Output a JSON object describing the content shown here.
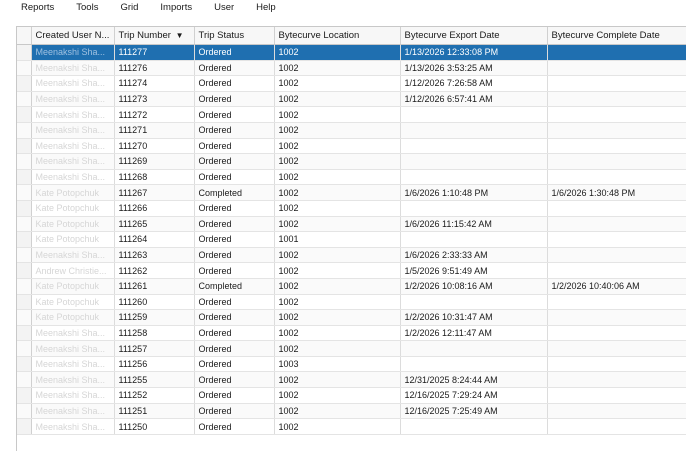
{
  "menu": [
    "Reports",
    "Tools",
    "Grid",
    "Imports",
    "User",
    "Help"
  ],
  "columns": {
    "created_user": "Created User N...",
    "trip_number": "Trip Number",
    "sort_indicator": "▼",
    "trip_status": "Trip Status",
    "bytecurve_location": "Bytecurve Location",
    "bytecurve_export_date": "Bytecurve Export Date",
    "bytecurve_complete_date": "Bytecurve Complete Date"
  },
  "rows": [
    {
      "user": "Meenakshi Sha...",
      "trip": "111277",
      "status": "Ordered",
      "location": "1002",
      "export": "1/13/2026 12:33:08 PM",
      "complete": "",
      "selected": true
    },
    {
      "user": "Meenakshi Sha...",
      "trip": "111276",
      "status": "Ordered",
      "location": "1002",
      "export": "1/13/2026 3:53:25 AM",
      "complete": ""
    },
    {
      "user": "Meenakshi Sha...",
      "trip": "111274",
      "status": "Ordered",
      "location": "1002",
      "export": "1/12/2026 7:26:58 AM",
      "complete": ""
    },
    {
      "user": "Meenakshi Sha...",
      "trip": "111273",
      "status": "Ordered",
      "location": "1002",
      "export": "1/12/2026 6:57:41 AM",
      "complete": ""
    },
    {
      "user": "Meenakshi Sha...",
      "trip": "111272",
      "status": "Ordered",
      "location": "1002",
      "export": "",
      "complete": ""
    },
    {
      "user": "Meenakshi Sha...",
      "trip": "111271",
      "status": "Ordered",
      "location": "1002",
      "export": "",
      "complete": ""
    },
    {
      "user": "Meenakshi Sha...",
      "trip": "111270",
      "status": "Ordered",
      "location": "1002",
      "export": "",
      "complete": ""
    },
    {
      "user": "Meenakshi Sha...",
      "trip": "111269",
      "status": "Ordered",
      "location": "1002",
      "export": "",
      "complete": ""
    },
    {
      "user": "Meenakshi Sha...",
      "trip": "111268",
      "status": "Ordered",
      "location": "1002",
      "export": "",
      "complete": ""
    },
    {
      "user": "Kate Potopchuk",
      "trip": "111267",
      "status": "Completed",
      "location": "1002",
      "export": "1/6/2026 1:10:48 PM",
      "complete": "1/6/2026 1:30:48 PM"
    },
    {
      "user": "Kate Potopchuk",
      "trip": "111266",
      "status": "Ordered",
      "location": "1002",
      "export": "",
      "complete": ""
    },
    {
      "user": "Kate Potopchuk",
      "trip": "111265",
      "status": "Ordered",
      "location": "1002",
      "export": "1/6/2026 11:15:42 AM",
      "complete": ""
    },
    {
      "user": "Kate Potopchuk",
      "trip": "111264",
      "status": "Ordered",
      "location": "1001",
      "export": "",
      "complete": ""
    },
    {
      "user": "Meenakshi Sha...",
      "trip": "111263",
      "status": "Ordered",
      "location": "1002",
      "export": "1/6/2026 2:33:33 AM",
      "complete": ""
    },
    {
      "user": "Andrew Christie...",
      "trip": "111262",
      "status": "Ordered",
      "location": "1002",
      "export": "1/5/2026 9:51:49 AM",
      "complete": ""
    },
    {
      "user": "Kate Potopchuk",
      "trip": "111261",
      "status": "Completed",
      "location": "1002",
      "export": "1/2/2026 10:08:16 AM",
      "complete": "1/2/2026 10:40:06 AM"
    },
    {
      "user": "Kate Potopchuk",
      "trip": "111260",
      "status": "Ordered",
      "location": "1002",
      "export": "",
      "complete": ""
    },
    {
      "user": "Kate Potopchuk",
      "trip": "111259",
      "status": "Ordered",
      "location": "1002",
      "export": "1/2/2026 10:31:47 AM",
      "complete": ""
    },
    {
      "user": "Meenakshi Sha...",
      "trip": "111258",
      "status": "Ordered",
      "location": "1002",
      "export": "1/2/2026 12:11:47 AM",
      "complete": ""
    },
    {
      "user": "Meenakshi Sha...",
      "trip": "111257",
      "status": "Ordered",
      "location": "1002",
      "export": "",
      "complete": ""
    },
    {
      "user": "Meenakshi Sha...",
      "trip": "111256",
      "status": "Ordered",
      "location": "1003",
      "export": "",
      "complete": ""
    },
    {
      "user": "Meenakshi Sha...",
      "trip": "111255",
      "status": "Ordered",
      "location": "1002",
      "export": "12/31/2025 8:24:44 AM",
      "complete": ""
    },
    {
      "user": "Meenakshi Sha...",
      "trip": "111252",
      "status": "Ordered",
      "location": "1002",
      "export": "12/16/2025 7:29:24 AM",
      "complete": ""
    },
    {
      "user": "Meenakshi Sha...",
      "trip": "111251",
      "status": "Ordered",
      "location": "1002",
      "export": "12/16/2025 7:25:49 AM",
      "complete": ""
    },
    {
      "user": "Meenakshi Sha...",
      "trip": "111250",
      "status": "Ordered",
      "location": "1002",
      "export": "",
      "complete": ""
    }
  ],
  "colors": {
    "selection": "#1f6fb0",
    "grid_line": "#dcdcdc",
    "user_text": "#d6d6d6"
  }
}
